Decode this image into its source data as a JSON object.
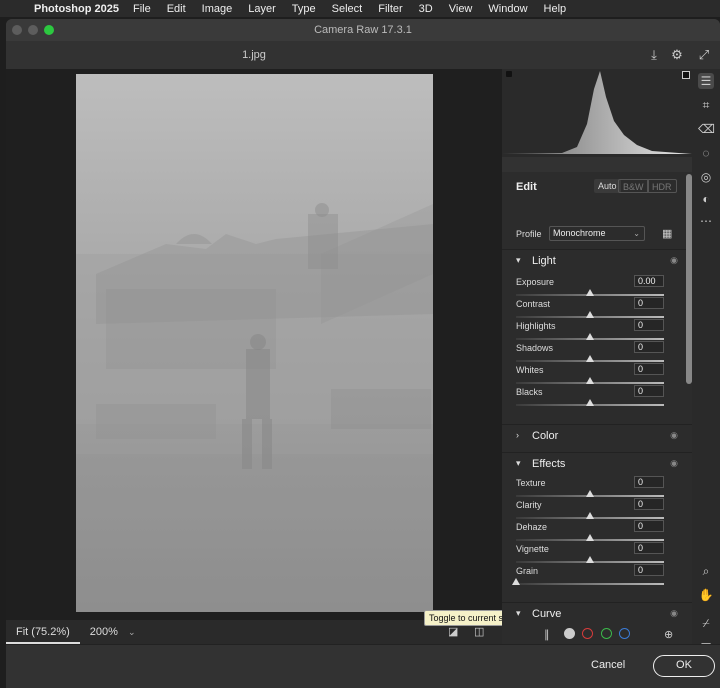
{
  "menubar": {
    "app": "Photoshop 2025",
    "items": [
      "File",
      "Edit",
      "Image",
      "Layer",
      "Type",
      "Select",
      "Filter",
      "3D",
      "View",
      "Window",
      "Help"
    ]
  },
  "window": {
    "title": "Camera Raw 17.3.1",
    "document": "1.jpg"
  },
  "edit": {
    "title": "Edit",
    "modes": [
      "Auto",
      "B&W",
      "HDR"
    ],
    "profile_label": "Profile",
    "profile_value": "Monochrome"
  },
  "light": {
    "title": "Light",
    "sliders": [
      {
        "label": "Exposure",
        "value": "0.00",
        "level": 0.5
      },
      {
        "label": "Contrast",
        "value": "0",
        "level": 0.5
      },
      {
        "label": "Highlights",
        "value": "0",
        "level": 0.5
      },
      {
        "label": "Shadows",
        "value": "0",
        "level": 0.5
      },
      {
        "label": "Whites",
        "value": "0",
        "level": 0.5
      },
      {
        "label": "Blacks",
        "value": "0",
        "level": 0.5
      }
    ]
  },
  "color": {
    "title": "Color"
  },
  "effects": {
    "title": "Effects",
    "sliders": [
      {
        "label": "Texture",
        "value": "0",
        "level": 0.5
      },
      {
        "label": "Clarity",
        "value": "0",
        "level": 0.5
      },
      {
        "label": "Dehaze",
        "value": "0",
        "level": 0.5
      },
      {
        "label": "Vignette",
        "value": "0",
        "level": 0.5
      },
      {
        "label": "Grain",
        "value": "0",
        "level": 0.0
      }
    ]
  },
  "curve": {
    "title": "Curve"
  },
  "zoom": {
    "fit": "Fit (75.2%)",
    "level": "200%"
  },
  "tooltip": "Toggle to current settings (\\)",
  "dialog": {
    "cancel": "Cancel",
    "ok": "OK"
  },
  "colors": {
    "ok_border": "#eeeeee",
    "curve_red": "#d63b3b",
    "curve_green": "#3bb84a",
    "curve_blue": "#3b7bd6",
    "maximize": "#2cc840"
  }
}
